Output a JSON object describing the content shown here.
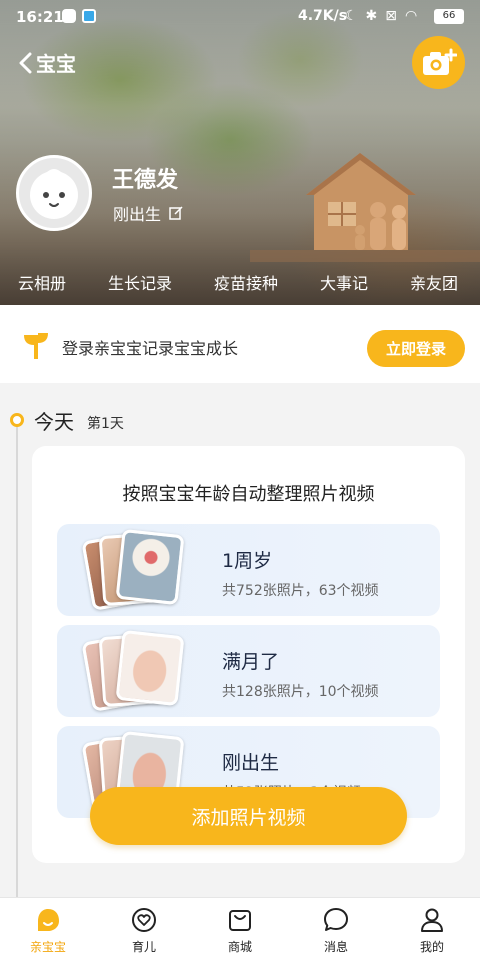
{
  "status_bar": {
    "time": "16:21",
    "network_speed": "4.7K/s",
    "battery": "66"
  },
  "header": {
    "back_label": "宝宝",
    "baby_name": "王德发",
    "baby_age": "刚出生"
  },
  "tabs": [
    "云相册",
    "生长记录",
    "疫苗接种",
    "大事记",
    "亲友团"
  ],
  "login_banner": {
    "text": "登录亲宝宝记录宝宝成长",
    "button": "立即登录"
  },
  "timeline": {
    "today": "今天",
    "day_count": "第1天"
  },
  "card": {
    "title": "按照宝宝年龄自动整理照片视频",
    "albums": [
      {
        "name": "1周岁",
        "meta": "共752张照片，63个视频"
      },
      {
        "name": "满月了",
        "meta": "共128张照片，10个视频"
      },
      {
        "name": "刚出生",
        "meta": "共52张照片，3个视频"
      }
    ]
  },
  "add_button": "添加照片视频",
  "bottom_nav": [
    {
      "label": "亲宝宝",
      "icon": "home-bubble-icon",
      "active": true
    },
    {
      "label": "育儿",
      "icon": "heart-icon",
      "active": false
    },
    {
      "label": "商城",
      "icon": "shopping-bag-icon",
      "active": false
    },
    {
      "label": "消息",
      "icon": "message-icon",
      "active": false
    },
    {
      "label": "我的",
      "icon": "user-icon",
      "active": false
    }
  ],
  "colors": {
    "accent": "#f8b61c",
    "active_nav": "#f3a60c"
  }
}
